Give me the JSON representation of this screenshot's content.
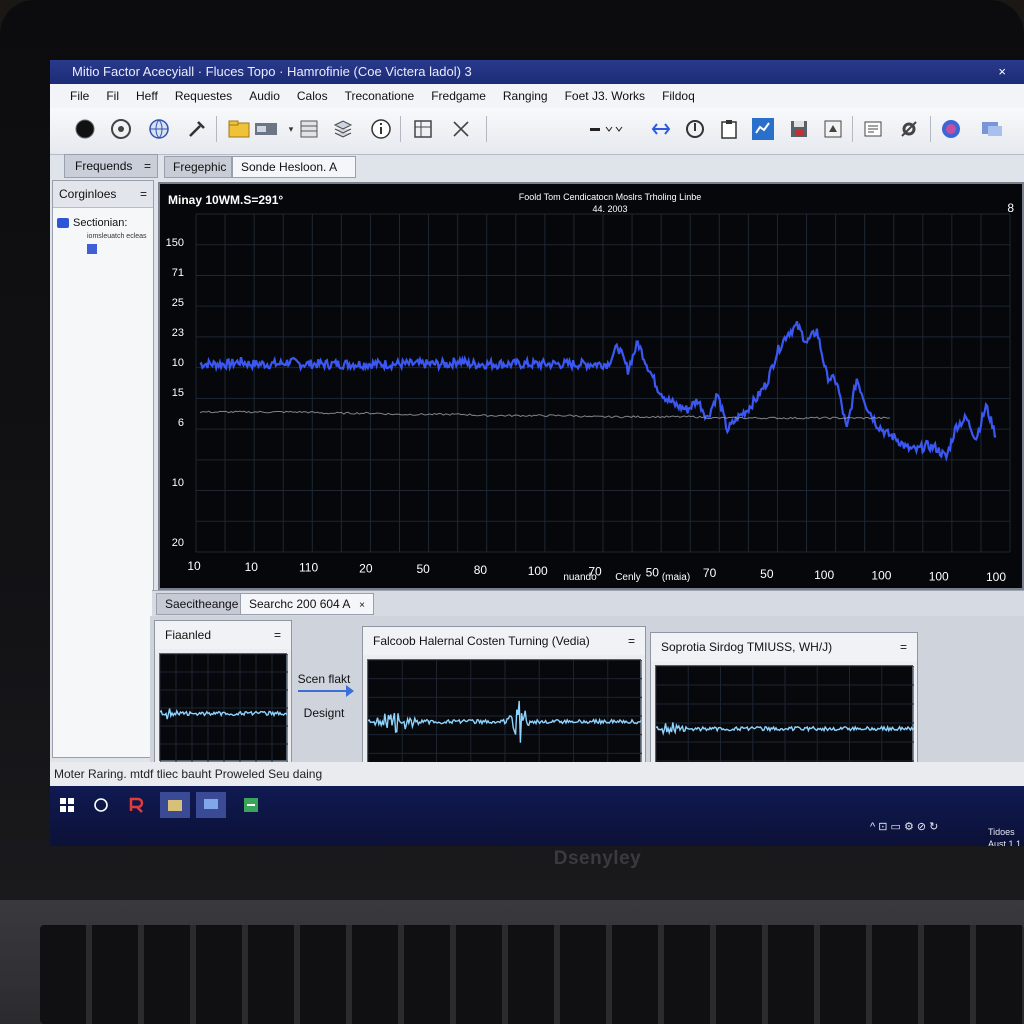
{
  "window": {
    "title": "Mitio Factor Acecyiall · Fluces Topo · Hamrofinie (Coe Victera ladol) 3",
    "close_glyph": "×"
  },
  "menu": [
    "File",
    "Fil",
    "Heff",
    "Requestes",
    "Audio",
    "Calos",
    "Treconatione",
    "Fredgame",
    "Ranging",
    "Foet J3. Works",
    "Fildoq"
  ],
  "toolbar": {
    "icons": [
      "record-icon",
      "target-icon",
      "globe-icon",
      "tool-icon",
      "folder-icon",
      "window-icon",
      "grid-icon",
      "stack-icon",
      "info-icon",
      "table-icon",
      "cut-icon",
      "line-style-icon",
      "filter-icon",
      "target-2-icon",
      "clipboard-icon",
      "chart-icon",
      "save-icon",
      "tag-icon",
      "list-icon",
      "settings-icon",
      "color-icon",
      "display-icon"
    ]
  },
  "left_pane": {
    "tab_label": "Frequends",
    "tab_menu": "=",
    "header": "Corginloes",
    "header_menu": "=",
    "tree_item": "Sectionian:",
    "tree_sub": "iomsleuatch ecleas"
  },
  "main_tabs": [
    {
      "label": "Fregephic",
      "active": false
    },
    {
      "label": "Sonde Hesloon. A",
      "active": true,
      "close": "×"
    }
  ],
  "chart_data": {
    "type": "line",
    "title": "Foold Tom Cendicatocn Moslrs Trholing Linbe",
    "subtitle": "44. 2003",
    "top_left_label": "Minay 10WM.S=291°",
    "top_right_label": "8",
    "y_tick_labels": [
      "150",
      "71",
      "25",
      "23",
      "10",
      "15",
      "6",
      "10",
      "20"
    ],
    "x_tick_labels": [
      "10",
      "10",
      "110",
      "20",
      "50",
      "80",
      "100",
      "70",
      "50",
      "70",
      "50",
      "100",
      "100",
      "100",
      "100"
    ],
    "x_axis_note": "nuando",
    "x_axis_note2": "Cenly",
    "x_axis_note3": "(maia)",
    "series": [
      {
        "color": "#3d5cff",
        "values": [
          10,
          10,
          10,
          10,
          10.2,
          10,
          10,
          10,
          10,
          10.2,
          10,
          10,
          10,
          10,
          10,
          10,
          10,
          10,
          10,
          10,
          10,
          10,
          10,
          10,
          10,
          10,
          10.3,
          10,
          10,
          10,
          10,
          10,
          10,
          10,
          10,
          10,
          10,
          10,
          10,
          10,
          10,
          10,
          11.5,
          9.5,
          11.8,
          9.8,
          8,
          7,
          6.5,
          6.2,
          7,
          5.5,
          7.5,
          4.5,
          5.5,
          6.2,
          7.2,
          8.5,
          11,
          12.5,
          13.2,
          11.8,
          12.8,
          9,
          8.5,
          4.5,
          8.8,
          6.5,
          5,
          4.2,
          3.8,
          3,
          2.8,
          3.2,
          3,
          2.2,
          4.8,
          5.5,
          3.8,
          6.5,
          4
        ],
        "noise": 0.4
      },
      {
        "color": "#9da3ad",
        "values": [
          6,
          6,
          6,
          6,
          6,
          6,
          6,
          5.9,
          5.9,
          5.9,
          5.9,
          5.8,
          5.8,
          5.8,
          5.8,
          5.8,
          5.7,
          5.7,
          5.7,
          5.7,
          5.7,
          5.7,
          5.6,
          5.6,
          5.6,
          5.6,
          5.6,
          5.6,
          5.6,
          5.5,
          5.5,
          5.5,
          5.5,
          5.5,
          5.5,
          5.5,
          5.5,
          5.5,
          5.5,
          5.5
        ],
        "noise": 0.08
      }
    ],
    "grid": true,
    "y_range": [
      0,
      20
    ]
  },
  "bottom_tabs": [
    {
      "label": "Saecitheange",
      "active": false
    },
    {
      "label": "Searchc 200 604 A",
      "active": true,
      "close": "×"
    }
  ],
  "panels": {
    "p1": {
      "title": "Fiaanled",
      "menu": "="
    },
    "p2": {
      "title": "Falcoob Halernal Costen Turning (Vedia)",
      "menu": "="
    },
    "p3": {
      "title": "Soprotia Sirdog TMIUSS, WH/J)",
      "menu": "="
    },
    "mid_top": "Scen flakt",
    "mid_bottom": "Designt"
  },
  "statusbar": "Moter Raring. mtdf tliec bauht Proweled Seu daing",
  "taskbar": {
    "icons": [
      "windows-start-icon",
      "search-circle-icon",
      "app-red-icon",
      "files-icon",
      "monitor-icon",
      "app-green-icon"
    ],
    "tray": "^ ⊡ ▭ ⚙ ⊘ ↻",
    "clock_line1": "Tidoes",
    "clock_line2": "Aust 1 1"
  },
  "laptop_brand": "Dsenyley"
}
